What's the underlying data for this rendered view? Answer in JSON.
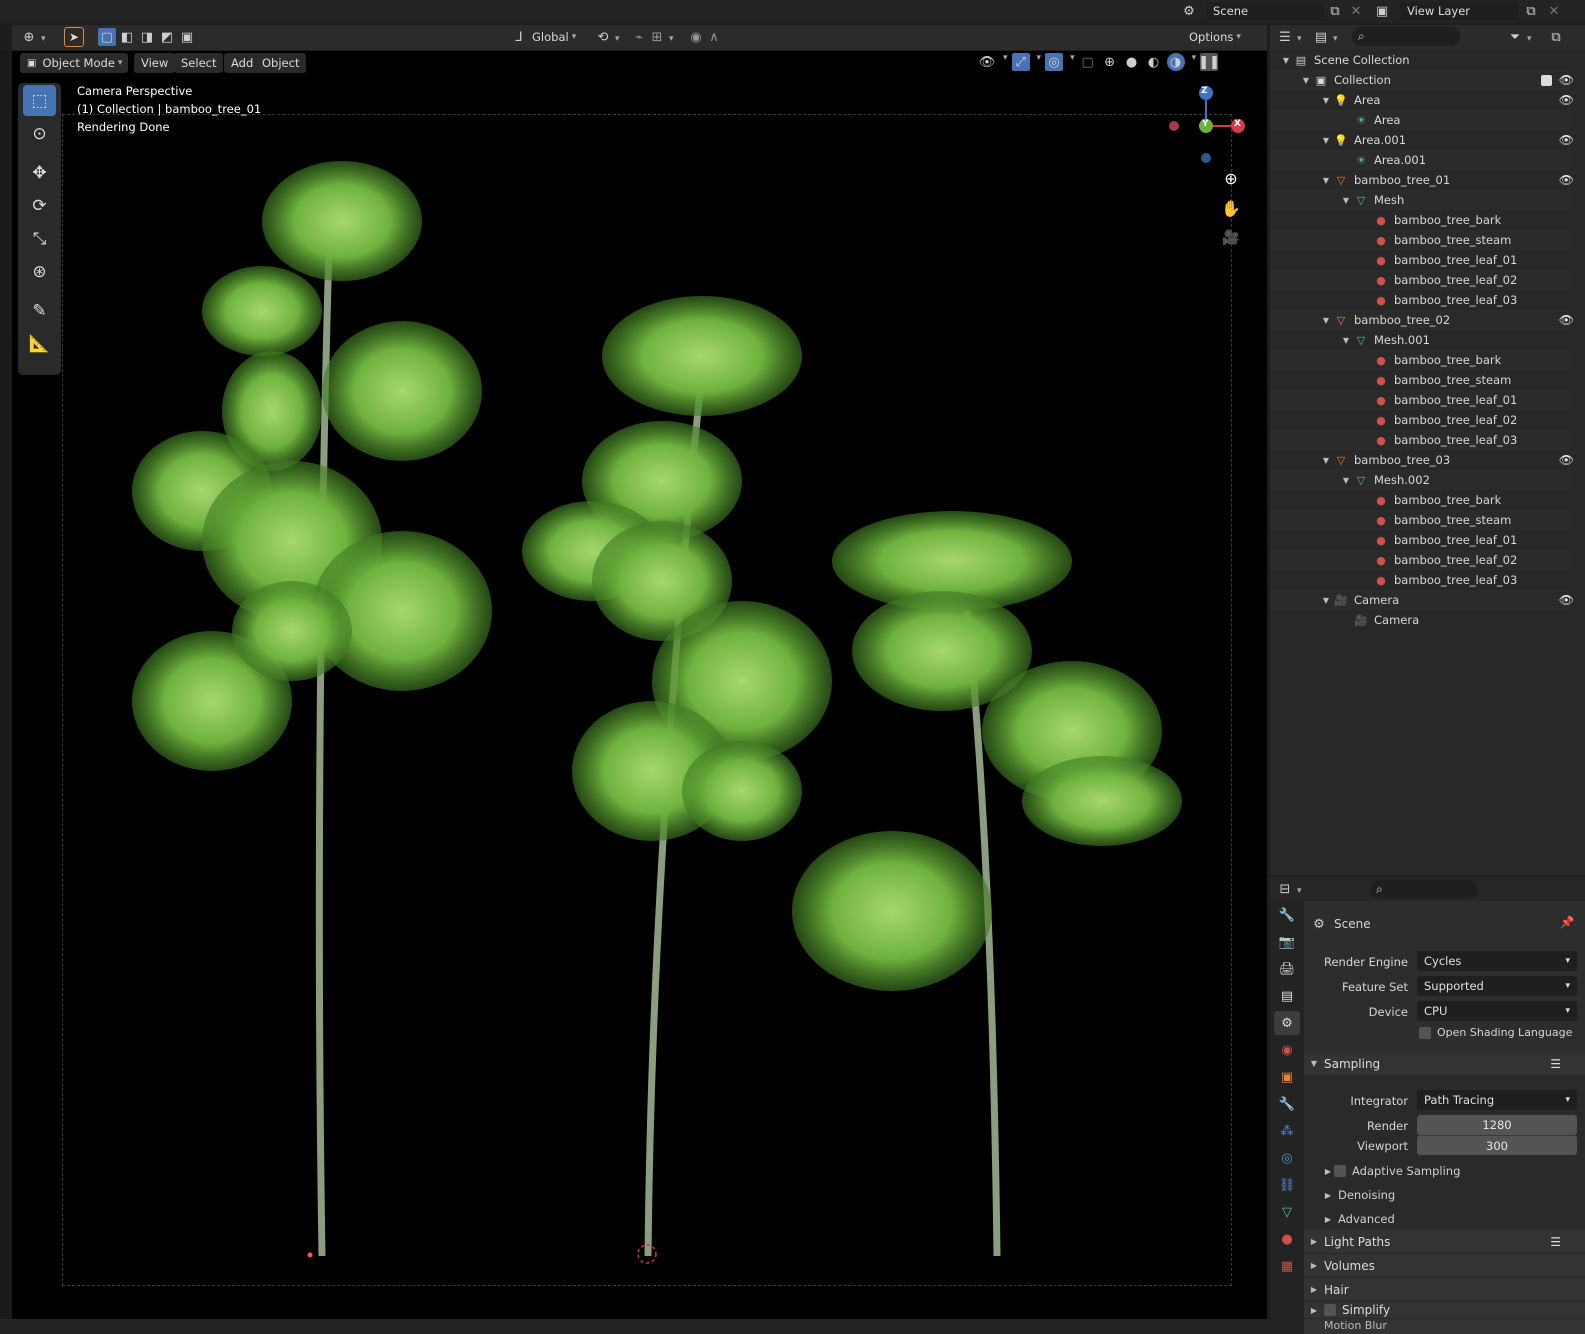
{
  "topbar": {
    "scene_label": "Scene",
    "view_layer_label": "View Layer"
  },
  "viewport_header": {
    "orientation": "Global",
    "options_label": "Options",
    "mode": "Object Mode",
    "menus": [
      "View",
      "Select",
      "Add",
      "Object"
    ]
  },
  "viewport": {
    "line1": "Camera Perspective",
    "line2": "(1) Collection | bamboo_tree_01",
    "line3": "Rendering Done",
    "gizmo_z": "Z",
    "gizmo_y": "Y",
    "gizmo_x": "X"
  },
  "outliner": {
    "rows": [
      {
        "label": "Scene Collection",
        "icon": "scene-collection-icon"
      },
      {
        "label": "Collection",
        "icon": "collection-icon"
      },
      {
        "label": "Area",
        "icon": "light-icon"
      },
      {
        "label": "Area",
        "icon": "light-data-icon"
      },
      {
        "label": "Area.001",
        "icon": "light-icon"
      },
      {
        "label": "Area.001",
        "icon": "light-data-icon"
      },
      {
        "label": "bamboo_tree_01",
        "icon": "mesh-object-icon"
      },
      {
        "label": "Mesh",
        "icon": "mesh-data-icon"
      },
      {
        "label": "bamboo_tree_bark",
        "icon": "material-icon"
      },
      {
        "label": "bamboo_tree_steam",
        "icon": "material-icon"
      },
      {
        "label": "bamboo_tree_leaf_01",
        "icon": "material-icon"
      },
      {
        "label": "bamboo_tree_leaf_02",
        "icon": "material-icon"
      },
      {
        "label": "bamboo_tree_leaf_03",
        "icon": "material-icon"
      },
      {
        "label": "bamboo_tree_02",
        "icon": "mesh-object-icon"
      },
      {
        "label": "Mesh.001",
        "icon": "mesh-data-icon"
      },
      {
        "label": "bamboo_tree_bark",
        "icon": "material-icon"
      },
      {
        "label": "bamboo_tree_steam",
        "icon": "material-icon"
      },
      {
        "label": "bamboo_tree_leaf_01",
        "icon": "material-icon"
      },
      {
        "label": "bamboo_tree_leaf_02",
        "icon": "material-icon"
      },
      {
        "label": "bamboo_tree_leaf_03",
        "icon": "material-icon"
      },
      {
        "label": "bamboo_tree_03",
        "icon": "mesh-object-icon"
      },
      {
        "label": "Mesh.002",
        "icon": "mesh-data-icon"
      },
      {
        "label": "bamboo_tree_bark",
        "icon": "material-icon"
      },
      {
        "label": "bamboo_tree_steam",
        "icon": "material-icon"
      },
      {
        "label": "bamboo_tree_leaf_01",
        "icon": "material-icon"
      },
      {
        "label": "bamboo_tree_leaf_02",
        "icon": "material-icon"
      },
      {
        "label": "bamboo_tree_leaf_03",
        "icon": "material-icon"
      },
      {
        "label": "Camera",
        "icon": "camera-object-icon"
      },
      {
        "label": "Camera",
        "icon": "camera-data-icon"
      }
    ]
  },
  "properties": {
    "context": "Scene",
    "render_engine_label": "Render Engine",
    "render_engine": "Cycles",
    "feature_set_label": "Feature Set",
    "feature_set": "Supported",
    "device_label": "Device",
    "device": "CPU",
    "osl_label": "Open Shading Language",
    "sampling_label": "Sampling",
    "integrator_label": "Integrator",
    "integrator": "Path Tracing",
    "render_label": "Render",
    "render_samples": "1280",
    "viewport_label": "Viewport",
    "viewport_samples": "300",
    "adaptive_label": "Adaptive Sampling",
    "denoising_label": "Denoising",
    "advanced_label": "Advanced",
    "light_paths_label": "Light Paths",
    "volumes_label": "Volumes",
    "hair_label": "Hair",
    "simplify_label": "Simplify",
    "motion_blur_label": "Motion Blur"
  },
  "colors": {
    "accent": "#4772b3",
    "leaf": "#7cbf4a",
    "stem": "#8a9a7a",
    "material": "#d0504a",
    "object_orange": "#e0893a",
    "mesh_green": "#4cc28d"
  }
}
